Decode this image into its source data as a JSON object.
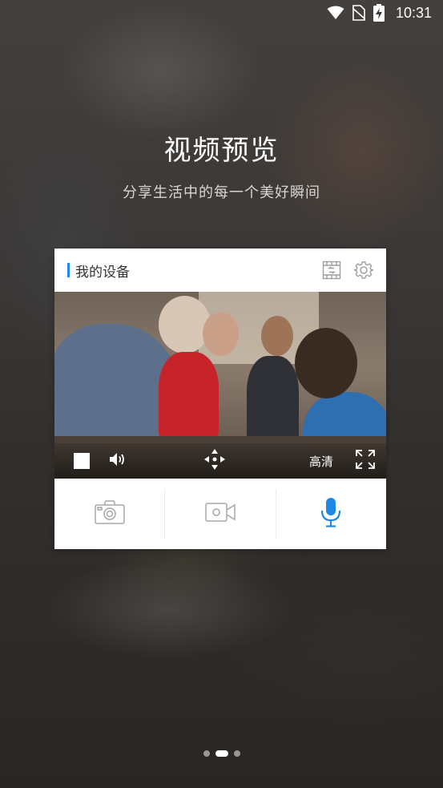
{
  "status": {
    "time": "10:31"
  },
  "onboarding": {
    "title": "视频预览",
    "subtitle": "分享生活中的每一个美好瞬间"
  },
  "card": {
    "title": "我的设备",
    "quality_label": "高清",
    "accent_color": "#1e88e5"
  },
  "icons": {
    "header": [
      "playback-icon",
      "settings-gear-icon"
    ],
    "controls": [
      "stop-icon",
      "volume-icon",
      "ptz-move-icon",
      "fullscreen-icon"
    ],
    "actions": [
      "camera-snapshot-icon",
      "video-record-icon",
      "microphone-icon"
    ]
  },
  "pager": {
    "pages": 3,
    "current": 2
  }
}
